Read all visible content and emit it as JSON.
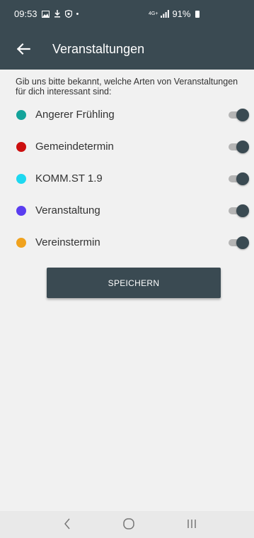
{
  "statusbar": {
    "time": "09:53",
    "network": "4G+",
    "battery": "91%",
    "icons": [
      "gallery-icon",
      "download-icon",
      "shield-icon",
      "dot-icon"
    ]
  },
  "appbar": {
    "title": "Veranstaltungen",
    "back_icon": "arrow-left-icon"
  },
  "intro_text": "Gib uns bitte bekannt, welche Arten von Veranstaltungen für dich interessant sind:",
  "categories": [
    {
      "label": "Angerer Frühling",
      "color": "#14a39a",
      "enabled": true
    },
    {
      "label": "Gemeindetermin",
      "color": "#cc0f0f",
      "enabled": true
    },
    {
      "label": "KOMM.ST 1.9",
      "color": "#1ed8f0",
      "enabled": true
    },
    {
      "label": "Veranstaltung",
      "color": "#5a3df0",
      "enabled": true
    },
    {
      "label": "Vereinstermin",
      "color": "#f0a21e",
      "enabled": true
    }
  ],
  "save_button": "SPEICHERN",
  "navbar": {
    "back": "chevron-left-icon",
    "home": "home-circle-icon",
    "recents": "recents-icon"
  }
}
